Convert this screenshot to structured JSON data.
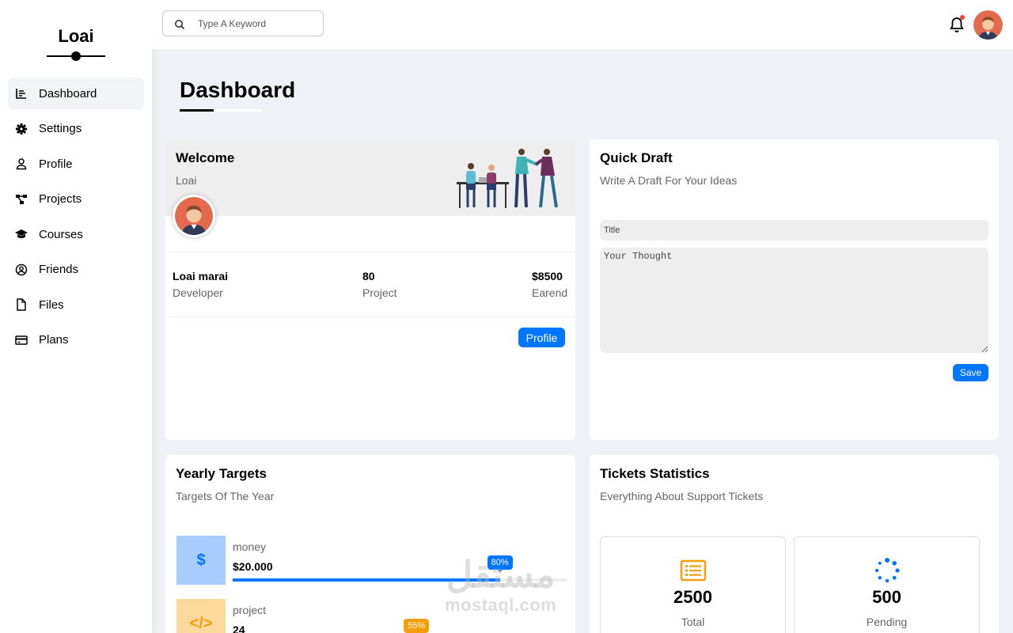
{
  "sidebar": {
    "logo": "Loai",
    "items": [
      {
        "label": "Dashboard",
        "icon": "chart-icon",
        "active": true
      },
      {
        "label": "Settings",
        "icon": "gear-icon"
      },
      {
        "label": "Profile",
        "icon": "user-icon"
      },
      {
        "label": "Projects",
        "icon": "diagram-icon"
      },
      {
        "label": "Courses",
        "icon": "graduation-cap-icon"
      },
      {
        "label": "Friends",
        "icon": "user-circle-icon"
      },
      {
        "label": "Files",
        "icon": "file-icon"
      },
      {
        "label": "Plans",
        "icon": "credit-card-icon"
      }
    ]
  },
  "header": {
    "search_placeholder": "Type A Keyword",
    "notification_badge_color": "#f44336"
  },
  "page": {
    "title": "Dashboard"
  },
  "welcome": {
    "title": "Welcome",
    "name": "Loai",
    "stats": [
      {
        "value": "Loai marai",
        "label": "Developer"
      },
      {
        "value": "80",
        "label": "Project"
      },
      {
        "value": "$8500",
        "label": "Earend"
      }
    ],
    "button": "Profile"
  },
  "draft": {
    "title": "Quick Draft",
    "subtitle": "Write A Draft For Your Ideas",
    "title_placeholder": "Title",
    "thought_placeholder": "Your Thought",
    "button": "Save"
  },
  "targets": {
    "title": "Yearly Targets",
    "subtitle": "Targets Of The Year",
    "items": [
      {
        "label": "money",
        "value": "$20.000",
        "percent": "80%",
        "fraction": 0.8,
        "color": "#0075ff",
        "bg": "#a8ceff",
        "icon": "dollar-icon",
        "glyph": "$"
      },
      {
        "label": "project",
        "value": "24",
        "percent": "55%",
        "fraction": 0.55,
        "color": "#f59e0b",
        "bg": "#fdd99b",
        "icon": "code-icon",
        "glyph": "</>"
      }
    ]
  },
  "tickets": {
    "title": "Tickets Statistics",
    "subtitle": "Everything About Support Tickets",
    "boxes": [
      {
        "number": "2500",
        "label": "Total",
        "icon": "list-icon",
        "color": "#f59e0b"
      },
      {
        "number": "500",
        "label": "Pending",
        "icon": "spinner-icon",
        "color": "#0075ff"
      }
    ]
  },
  "watermark": {
    "arabic": "مستقل",
    "latin": "mostaql.com"
  },
  "colors": {
    "accent": "#0075ff",
    "background": "#eef1f5"
  }
}
